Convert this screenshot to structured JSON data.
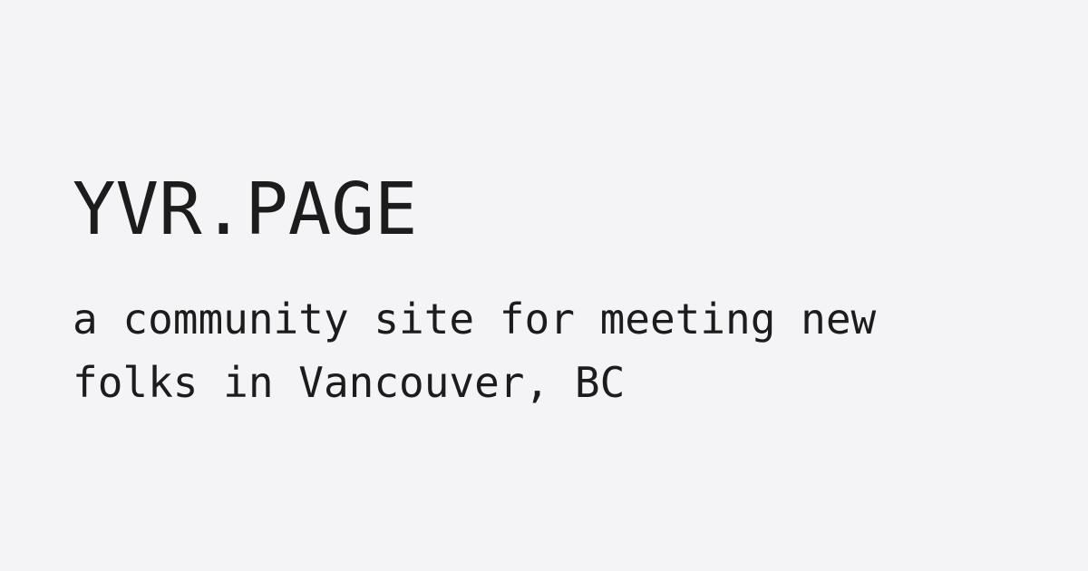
{
  "site": {
    "title": "YVR.PAGE",
    "tagline_lines": [
      "a community site for meeting new",
      "folks in Vancouver, BC"
    ]
  },
  "colors": {
    "background": "#f4f4f6",
    "text": "#1c1c1c"
  }
}
